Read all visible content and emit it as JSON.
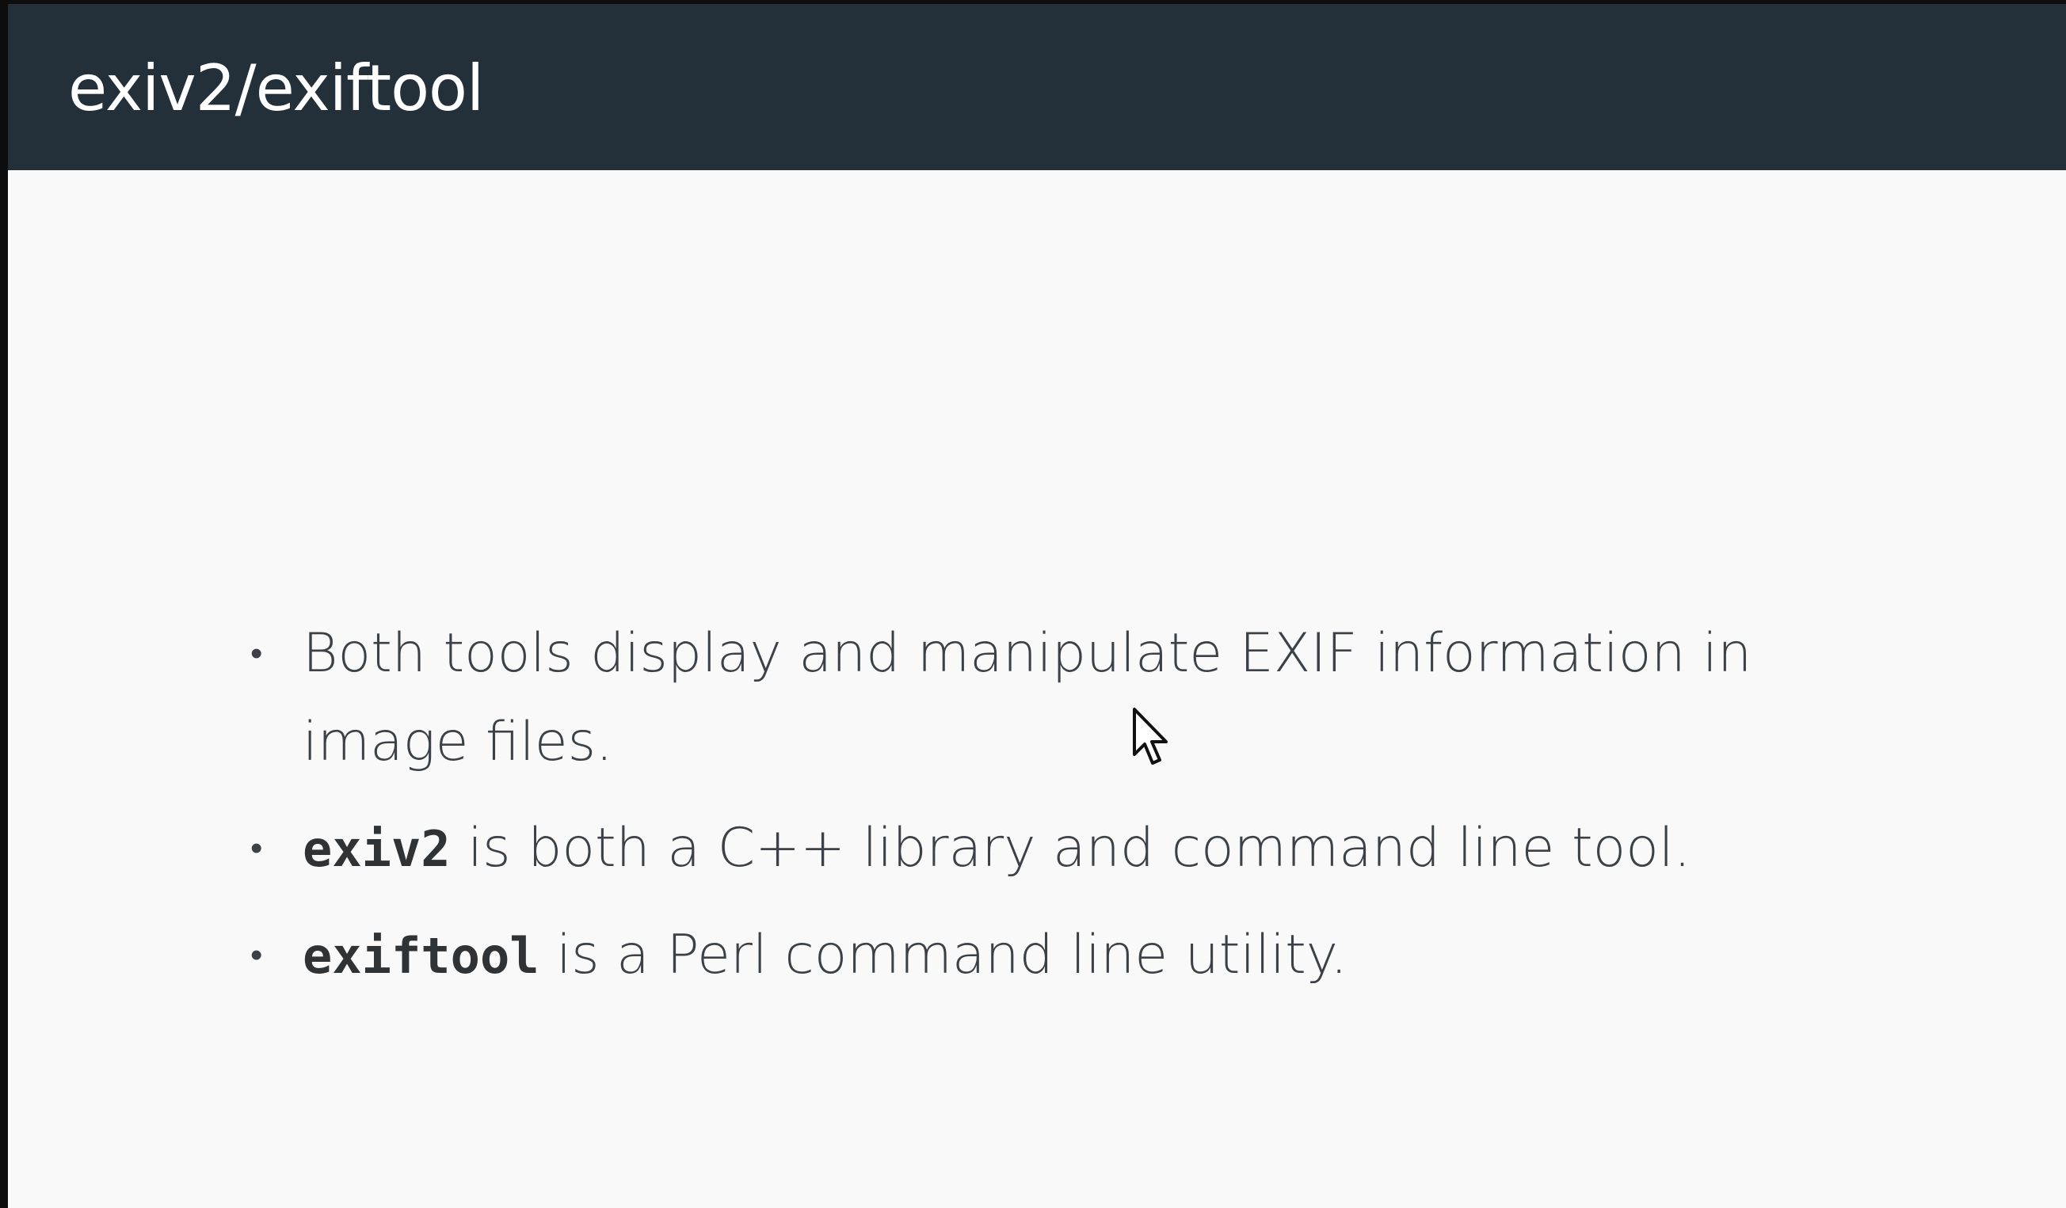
{
  "slide": {
    "title": "exiv2/exiftool",
    "bullets": [
      {
        "text": "Both tools display and manipulate EXIF information in image files."
      },
      {
        "code": "exiv2",
        "text": " is both a C++ library and command line tool."
      },
      {
        "code": "exiftool",
        "text": " is a Perl command line utility."
      }
    ],
    "bullet_marker": "•"
  },
  "colors": {
    "title_bar": "#23303a",
    "title_text": "#ffffff",
    "slide_background": "#f9f9fa",
    "body_text": "#3b4147",
    "outer_frame": "#0d0d0d"
  },
  "icons": {
    "cursor": "mouse-pointer-icon"
  }
}
